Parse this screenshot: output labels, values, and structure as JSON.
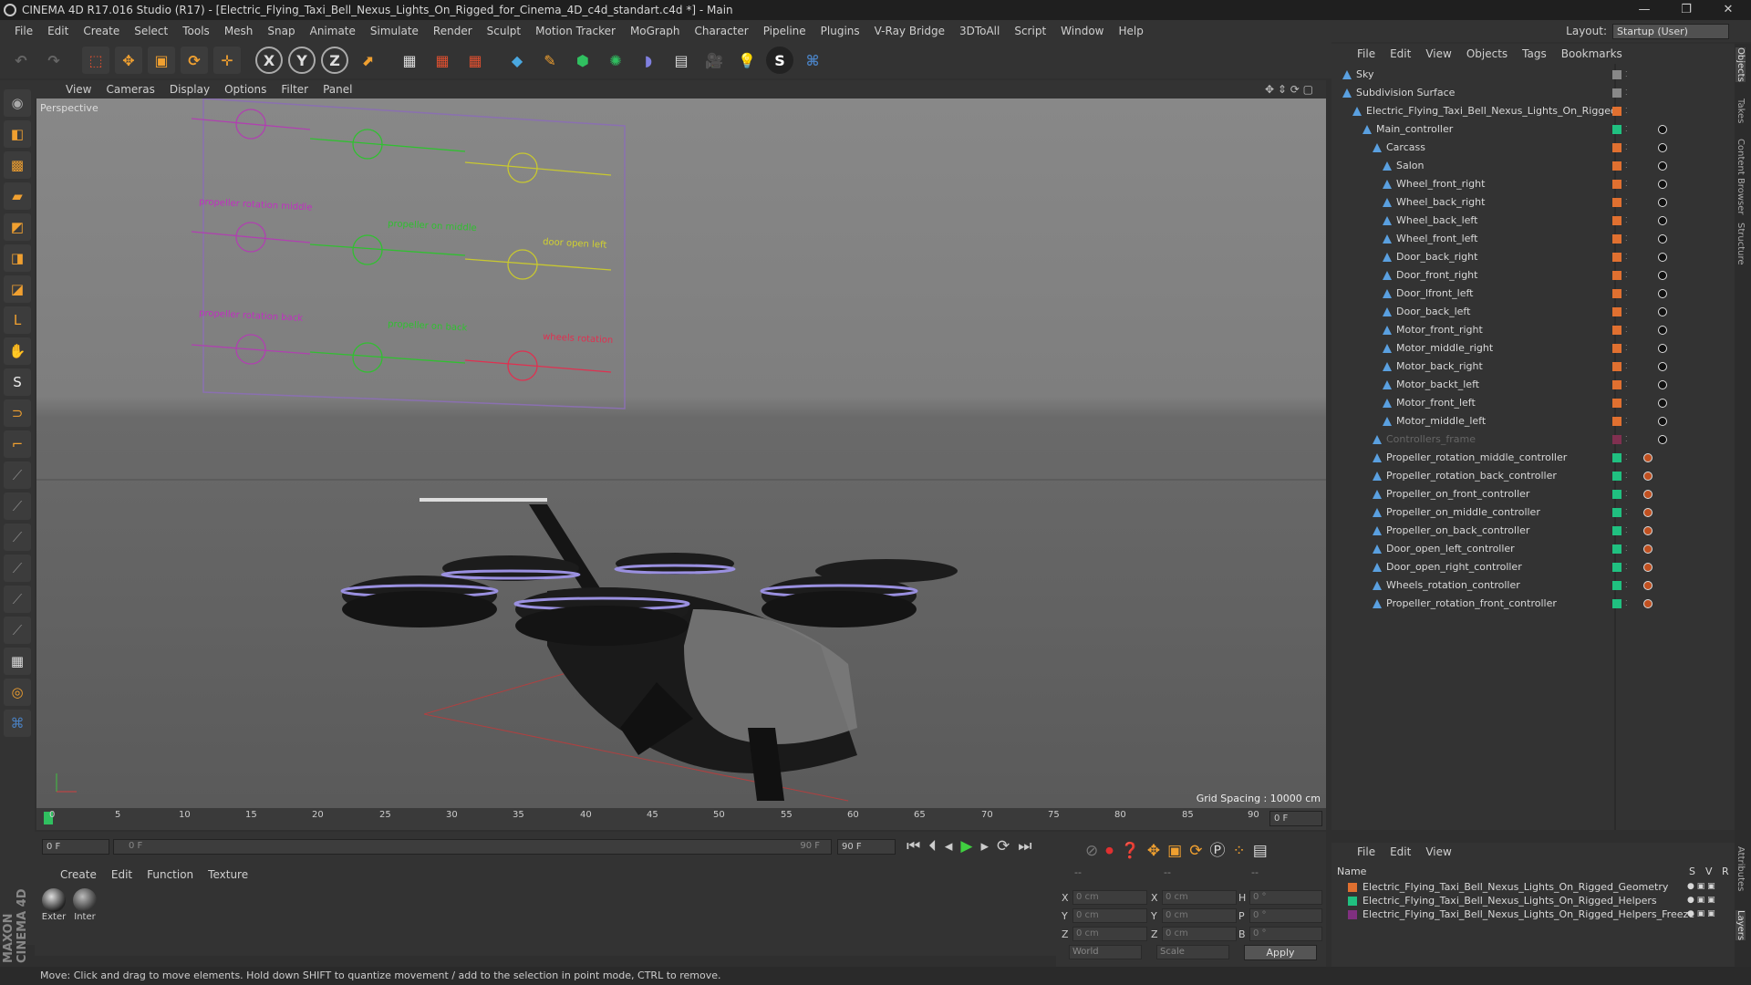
{
  "title": "CINEMA 4D R17.016 Studio (R17) - [Electric_Flying_Taxi_Bell_Nexus_Lights_On_Rigged_for_Cinema_4D_c4d_standart.c4d *] - Main",
  "menu": [
    "File",
    "Edit",
    "Create",
    "Select",
    "Tools",
    "Mesh",
    "Snap",
    "Animate",
    "Simulate",
    "Render",
    "Sculpt",
    "Motion Tracker",
    "MoGraph",
    "Character",
    "Pipeline",
    "Plugins",
    "V-Ray Bridge",
    "3DToAll",
    "Script",
    "Window",
    "Help"
  ],
  "layout": {
    "label": "Layout:",
    "value": "Startup (User)"
  },
  "toolbar_axes": [
    "X",
    "Y",
    "Z"
  ],
  "viewport": {
    "menu": [
      "View",
      "Cameras",
      "Display",
      "Options",
      "Filter",
      "Panel"
    ],
    "label": "Perspective",
    "grid_spacing": "Grid Spacing : 10000 cm",
    "rig_labels": [
      {
        "text": "propeller rotation middle",
        "color": "#c030c0"
      },
      {
        "text": "propeller on middle",
        "color": "#30c030"
      },
      {
        "text": "door open left",
        "color": "#d0d030"
      },
      {
        "text": "propeller rotation back",
        "color": "#c030c0"
      },
      {
        "text": "propeller on back",
        "color": "#30c030"
      },
      {
        "text": "wheels rotation",
        "color": "#e03050"
      }
    ]
  },
  "timeline": {
    "ticks": [
      "0",
      "5",
      "10",
      "15",
      "20",
      "25",
      "30",
      "35",
      "40",
      "45",
      "50",
      "55",
      "60",
      "65",
      "70",
      "75",
      "80",
      "85",
      "90"
    ],
    "current_frame": "0 F",
    "start_field": "0 F",
    "range_start": "0 F",
    "range_end": "90 F",
    "end_field": "90 F"
  },
  "materials": {
    "menu": [
      "Create",
      "Edit",
      "Function",
      "Texture"
    ],
    "items": [
      "Exter",
      "Inter"
    ]
  },
  "coords": {
    "header": [
      "--",
      "--",
      "--"
    ],
    "rows": [
      {
        "a": "X",
        "v1": "0 cm",
        "b": "X",
        "v2": "0 cm",
        "c": "H",
        "v3": "0 °"
      },
      {
        "a": "Y",
        "v1": "0 cm",
        "b": "Y",
        "v2": "0 cm",
        "c": "P",
        "v3": "0 °"
      },
      {
        "a": "Z",
        "v1": "0 cm",
        "b": "Z",
        "v2": "0 cm",
        "c": "B",
        "v3": "0 °"
      }
    ],
    "world": "World",
    "scale": "Scale",
    "apply": "Apply"
  },
  "status": "Move: Click and drag to move elements. Hold down SHIFT to quantize movement / add to the selection in point mode, CTRL to remove.",
  "objects": {
    "menu": [
      "File",
      "Edit",
      "View",
      "Objects",
      "Tags",
      "Bookmarks"
    ],
    "rows": [
      {
        "name": "Sky",
        "indent": 0,
        "color": "#888"
      },
      {
        "name": "Subdivision Surface",
        "indent": 0,
        "color": "#888"
      },
      {
        "name": "Electric_Flying_Taxi_Bell_Nexus_Lights_On_Rigged",
        "indent": 1,
        "color": "#e07030"
      },
      {
        "name": "Main_controller",
        "indent": 2,
        "color": "#20c080"
      },
      {
        "name": "Carcass",
        "indent": 3,
        "color": "#e07030"
      },
      {
        "name": "Salon",
        "indent": 4,
        "color": "#e07030"
      },
      {
        "name": "Wheel_front_right",
        "indent": 4,
        "color": "#e07030"
      },
      {
        "name": "Wheel_back_right",
        "indent": 4,
        "color": "#e07030"
      },
      {
        "name": "Wheel_back_left",
        "indent": 4,
        "color": "#e07030"
      },
      {
        "name": "Wheel_front_left",
        "indent": 4,
        "color": "#e07030"
      },
      {
        "name": "Door_back_right",
        "indent": 4,
        "color": "#e07030"
      },
      {
        "name": "Door_front_right",
        "indent": 4,
        "color": "#e07030"
      },
      {
        "name": "Door_lfront_left",
        "indent": 4,
        "color": "#e07030"
      },
      {
        "name": "Door_back_left",
        "indent": 4,
        "color": "#e07030"
      },
      {
        "name": "Motor_front_right",
        "indent": 4,
        "color": "#e07030"
      },
      {
        "name": "Motor_middle_right",
        "indent": 4,
        "color": "#e07030"
      },
      {
        "name": "Motor_back_right",
        "indent": 4,
        "color": "#e07030"
      },
      {
        "name": "Motor_backt_left",
        "indent": 4,
        "color": "#e07030"
      },
      {
        "name": "Motor_front_left",
        "indent": 4,
        "color": "#e07030"
      },
      {
        "name": "Motor_middle_left",
        "indent": 4,
        "color": "#e07030"
      },
      {
        "name": "Controllers_frame",
        "indent": 3,
        "color": "#803050"
      },
      {
        "name": "Propeller_rotation_middle_controller",
        "indent": 3,
        "color": "#20c080"
      },
      {
        "name": "Propeller_rotation_back_controller",
        "indent": 3,
        "color": "#20c080"
      },
      {
        "name": "Propeller_on_front_controller",
        "indent": 3,
        "color": "#20c080"
      },
      {
        "name": "Propeller_on_middle_controller",
        "indent": 3,
        "color": "#20c080"
      },
      {
        "name": "Propeller_on_back_controller",
        "indent": 3,
        "color": "#20c080"
      },
      {
        "name": "Door_open_left_controller",
        "indent": 3,
        "color": "#20c080"
      },
      {
        "name": "Door_open_right_controller",
        "indent": 3,
        "color": "#20c080"
      },
      {
        "name": "Wheels_rotation_controller",
        "indent": 3,
        "color": "#20c080"
      },
      {
        "name": "Propeller_rotation_front_controller",
        "indent": 3,
        "color": "#20c080"
      }
    ]
  },
  "layers": {
    "menu": [
      "File",
      "Edit",
      "View"
    ],
    "header_name": "Name",
    "header_flags": [
      "S",
      "V",
      "R"
    ],
    "rows": [
      {
        "name": "Electric_Flying_Taxi_Bell_Nexus_Lights_On_Rigged_Geometry",
        "color": "#e07030"
      },
      {
        "name": "Electric_Flying_Taxi_Bell_Nexus_Lights_On_Rigged_Helpers",
        "color": "#20c080"
      },
      {
        "name": "Electric_Flying_Taxi_Bell_Nexus_Lights_On_Rigged_Helpers_Freeze",
        "color": "#803080"
      }
    ]
  },
  "right_tabs": [
    "Objects",
    "Takes",
    "Content Browser",
    "Structure",
    "Attributes",
    "Layers"
  ],
  "brand": "MAXON CINEMA 4D"
}
